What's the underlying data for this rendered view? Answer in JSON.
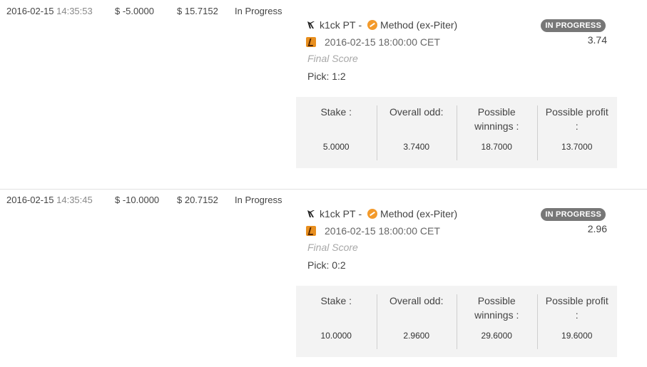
{
  "colors": {
    "badge_bg": "#777777",
    "summary_bg": "#f3f3f3",
    "game_icon": "#e88f1f",
    "team_logo": "#f39a2b"
  },
  "icons": {
    "team1": "k1ck-logo-icon",
    "team2": "method-logo-icon",
    "game": "counter-strike-icon"
  },
  "summary_labels": {
    "stake": "Stake :",
    "overall_odd": "Overall odd:",
    "possible_winnings": "Possible winnings :",
    "possible_profit": "Possible profit :"
  },
  "bets": [
    {
      "date": "2016-02-15",
      "time": "14:35:53",
      "change": "$ -5.0000",
      "balance": "$ 15.7152",
      "status": "In Progress",
      "team1": "k1ck PT",
      "separator": " - ",
      "team2": "Method (ex-Piter)",
      "match_datetime": "2016-02-15 18:00:00 CET",
      "final_score": "Final Score",
      "pick": "Pick: 1:2",
      "badge": "IN PROGRESS",
      "odd": "3.74",
      "stake": "5.0000",
      "overall_odd": "3.7400",
      "possible_winnings": "18.7000",
      "possible_profit": "13.7000"
    },
    {
      "date": "2016-02-15",
      "time": "14:35:45",
      "change": "$ -10.0000",
      "balance": "$ 20.7152",
      "status": "In Progress",
      "team1": "k1ck PT",
      "separator": " - ",
      "team2": "Method (ex-Piter)",
      "match_datetime": "2016-02-15 18:00:00 CET",
      "final_score": "Final Score",
      "pick": "Pick: 0:2",
      "badge": "IN PROGRESS",
      "odd": "2.96",
      "stake": "10.0000",
      "overall_odd": "2.9600",
      "possible_winnings": "29.6000",
      "possible_profit": "19.6000"
    }
  ]
}
